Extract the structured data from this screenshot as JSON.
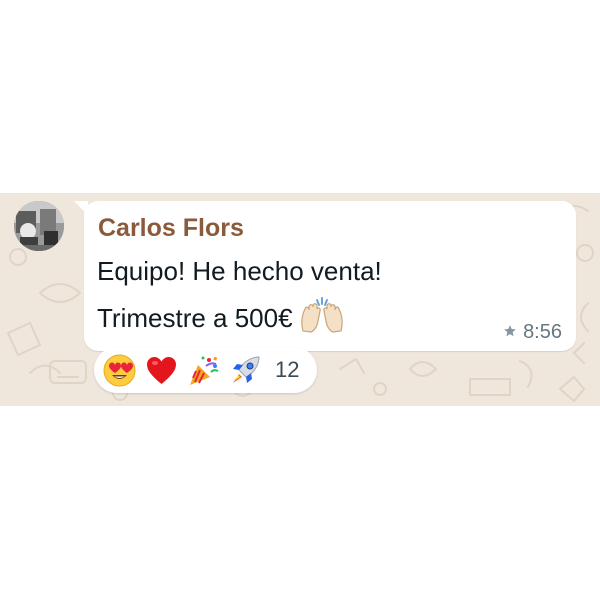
{
  "colors": {
    "wallpaper": "#efe7dc",
    "bubble": "#ffffff",
    "sender_name": "#8b5a3c",
    "text": "#111b21",
    "meta": "#667781"
  },
  "message": {
    "sender": "Carlos Flors",
    "lines": [
      "Equipo! He hecho venta!",
      "Trimestre a 500€"
    ],
    "inline_emoji": "raising-hands",
    "starred": true,
    "time": "8:56"
  },
  "reactions": {
    "emojis": [
      "heart-eyes",
      "red-heart",
      "party-popper",
      "rocket"
    ],
    "count": "12"
  }
}
